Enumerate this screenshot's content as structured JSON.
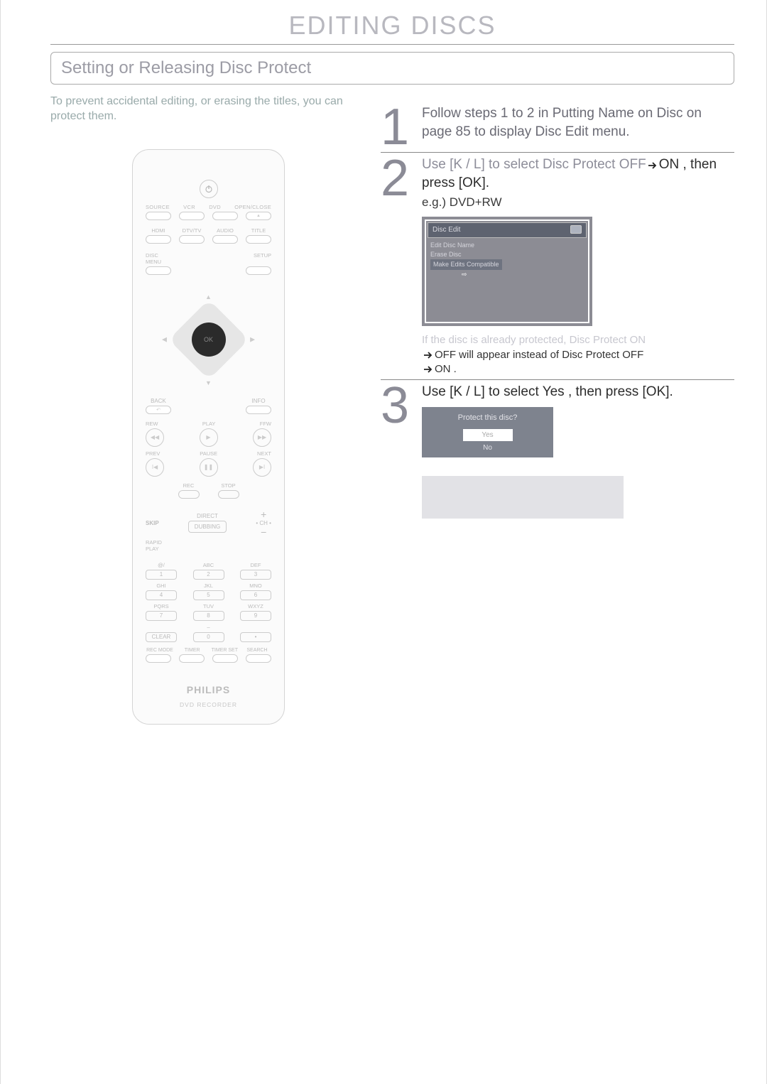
{
  "page_title": "EDITING DISCS",
  "subheading": "Setting or Releasing Disc Protect",
  "intro": "To prevent accidental editing, or erasing the titles, you can protect them.",
  "remote": {
    "row1_labels": [
      "SOURCE",
      "VCR",
      "DVD",
      "OPEN/CLOSE"
    ],
    "row2_labels": [
      "HDMI",
      "DTV/TV",
      "AUDIO",
      "TITLE"
    ],
    "disc_menu_label": "DISC MENU",
    "setup_label": "SETUP",
    "ok_label": "OK",
    "back_label": "BACK",
    "info_label": "INFO",
    "rew_label": "REW",
    "play_label": "PLAY",
    "ffw_label": "FFW",
    "prev_label": "PREV",
    "pause_label": "PAUSE",
    "next_label": "NEXT",
    "rec_label": "REC",
    "stop_label": "STOP",
    "skip_label": "SKIP",
    "direct_label": "DIRECT",
    "dubbing_label": "DUBBING",
    "ch_label": "• CH •",
    "rapid_label": "RAPID\nPLAY",
    "keypad_letters": [
      "@/",
      "ABC",
      "DEF",
      "GHI",
      "JKL",
      "MNO",
      "PQRS",
      "TUV",
      "WXYZ"
    ],
    "keypad_nums": [
      "1",
      "2",
      "3",
      "4",
      "5",
      "6",
      "7",
      "8",
      "9",
      "CLEAR",
      "0",
      "•"
    ],
    "bottom_labels": [
      "REC MODE",
      "TIMER",
      "TIMER SET",
      "SEARCH"
    ],
    "brand": "PHILIPS",
    "device": "DVD RECORDER"
  },
  "steps": {
    "s1_num": "1",
    "s1_text_a": "Follow steps 1 to 2 in  Putting Name on Disc  on page 85 to display  Disc Edit  menu.",
    "s2_num": "2",
    "s2_line1_pre": "Use [",
    "s2_line1_kl": "K / L",
    "s2_line1_mid": "] to select  Disc Protect OFF",
    "s2_line1_on": "ON",
    "s2_line1_post": ", then press [OK].",
    "s2_eg": "e.g.) DVD+RW",
    "s2_osd_title": "Disc Edit",
    "s2_osd_items": [
      "Edit Disc Name",
      "Erase Disc",
      "Make Edits Compatible"
    ],
    "s2_note_faded": "If the disc is already protected,  Disc Protect ON",
    "s2_note_line2_a": "OFF  will appear instead of  Disc Protect OFF",
    "s2_note_line2_b": "ON .",
    "s3_num": "3",
    "s3_line_pre": "Use [",
    "s3_line_kl": "K / L",
    "s3_line_post": "] to select  Yes , then press [OK].",
    "s3_confirm_q": "Protect this disc?",
    "s3_yes": "Yes",
    "s3_no": "No"
  }
}
